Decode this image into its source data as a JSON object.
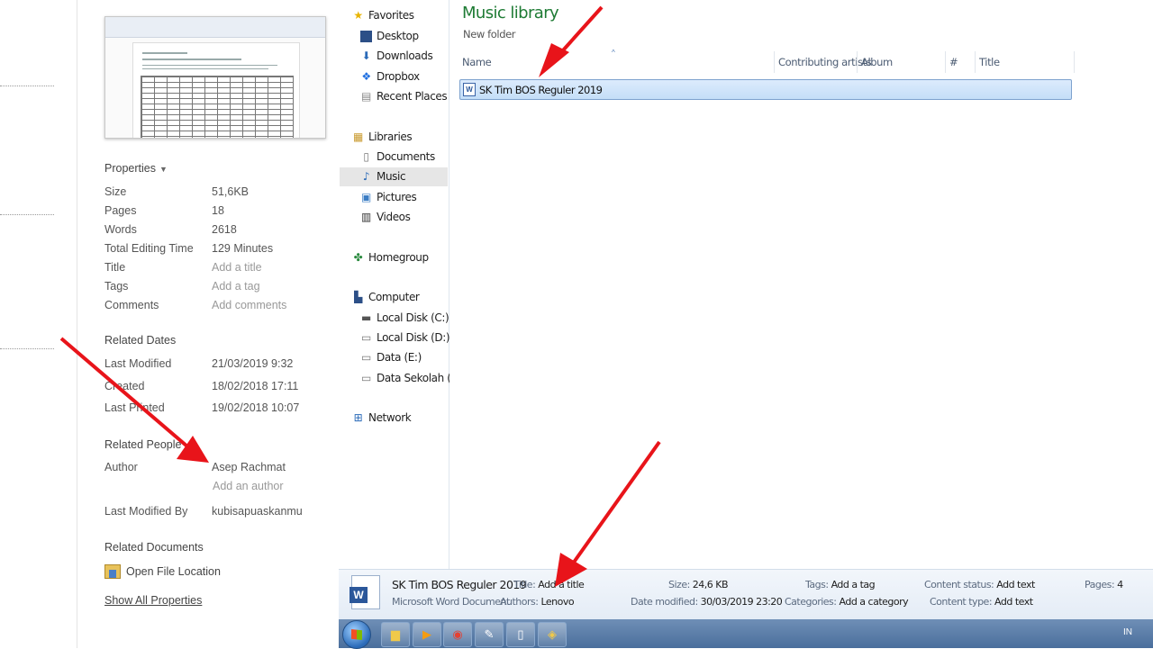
{
  "properties_panel": {
    "properties_header": "Properties",
    "props": [
      {
        "label": "Size",
        "value": "51,6KB",
        "placeholder": false
      },
      {
        "label": "Pages",
        "value": "18",
        "placeholder": false
      },
      {
        "label": "Words",
        "value": "2618",
        "placeholder": false
      },
      {
        "label": "Total Editing Time",
        "value": "129 Minutes",
        "placeholder": false
      },
      {
        "label": "Title",
        "value": "Add a title",
        "placeholder": true
      },
      {
        "label": "Tags",
        "value": "Add a tag",
        "placeholder": true
      },
      {
        "label": "Comments",
        "value": "Add comments",
        "placeholder": true
      }
    ],
    "related_dates_header": "Related Dates",
    "dates": [
      {
        "label": "Last Modified",
        "value": "21/03/2019 9:32"
      },
      {
        "label": "Created",
        "value": "18/02/2018 17:11"
      },
      {
        "label": "Last Printed",
        "value": "19/02/2018 10:07"
      }
    ],
    "related_people_header": "Related People",
    "author_label": "Author",
    "author_value": "Asep Rachmat",
    "add_author": "Add an author",
    "last_modified_by_label": "Last Modified By",
    "last_modified_by_value": "kubisapuaskanmu",
    "related_documents_header": "Related Documents",
    "open_file_location": "Open File Location",
    "show_all_properties": "Show All Properties"
  },
  "nav": {
    "favorites": "Favorites",
    "desktop": "Desktop",
    "downloads": "Downloads",
    "dropbox": "Dropbox",
    "recent_places": "Recent Places",
    "libraries": "Libraries",
    "documents": "Documents",
    "music": "Music",
    "pictures": "Pictures",
    "videos": "Videos",
    "homegroup": "Homegroup",
    "computer": "Computer",
    "local_disk_c": "Local Disk (C:)",
    "local_disk_d": "Local Disk (D:)",
    "data_e": "Data  (E:)",
    "data_sekolah_f": "Data Sekolah (F:)",
    "network": "Network"
  },
  "content": {
    "library_title": "Music library",
    "subtitle": "New folder",
    "columns": {
      "name": "Name",
      "contributing_artists": "Contributing artists",
      "album": "Album",
      "number": "#",
      "title": "Title"
    },
    "files": [
      {
        "name": "SK Tim BOS Reguler 2019"
      }
    ]
  },
  "details": {
    "filename": "SK Tim BOS Reguler 2019",
    "filetype": "Microsoft Word Document",
    "title_label": "Title:",
    "title_value": "Add a title",
    "authors_label": "Authors:",
    "authors_value": "Lenovo",
    "size_label": "Size:",
    "size_value": "24,6 KB",
    "date_modified_label": "Date modified:",
    "date_modified_value": "30/03/2019 23:20",
    "tags_label": "Tags:",
    "tags_value": "Add a tag",
    "categories_label": "Categories:",
    "categories_value": "Add a category",
    "content_status_label": "Content status:",
    "content_status_value": "Add text",
    "content_type_label": "Content type:",
    "content_type_value": "Add text",
    "pages_label": "Pages:",
    "pages_value": "4"
  },
  "taskbar": {
    "tray_language": "IN"
  },
  "colors": {
    "library_title": "#1e7b34",
    "arrow": "#e8141a",
    "selection": "#c4def8"
  }
}
